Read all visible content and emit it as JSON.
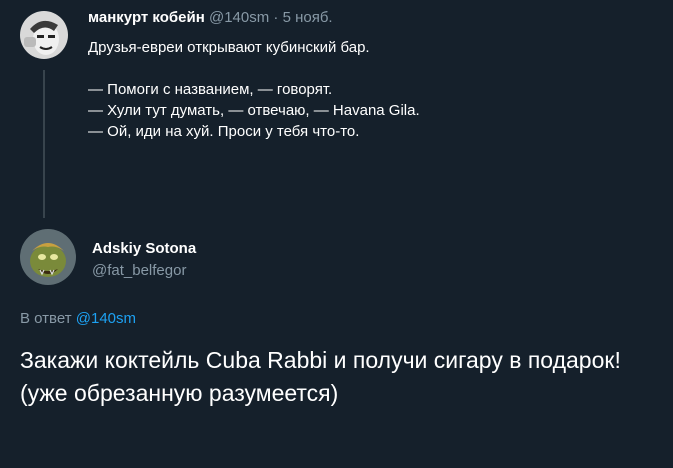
{
  "parent_tweet": {
    "display_name": "манкурт кобейн",
    "handle": "@140sm",
    "separator": "·",
    "date": "5 нояб.",
    "lines": [
      "Друзья-евреи открывают кубинский бар.",
      "",
      "— Помоги с названием, — говорят.",
      "— Хули тут думать, — отвечаю, — Havana Gila.",
      "— Ой, иди на хуй. Проси у тебя что-то."
    ]
  },
  "reply_tweet": {
    "display_name": "Adskiy Sotona",
    "handle": "@fat_belfegor",
    "replying_prefix": "В ответ",
    "replying_handle": "@140sm",
    "text": "Закажи коктейль Cuba Rabbi и получи сигару в подарок! (уже обрезанную разумеется)"
  },
  "colors": {
    "background": "#15202b",
    "muted_text": "#8899a6",
    "link": "#1da1f2",
    "thread_line": "#38444d"
  }
}
